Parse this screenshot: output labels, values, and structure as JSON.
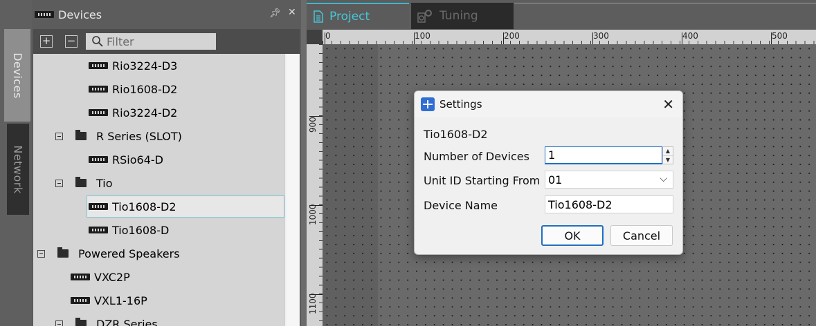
{
  "side_tabs": {
    "devices": "Devices",
    "network": "Network"
  },
  "devices_panel": {
    "title": "Devices",
    "filter_placeholder": "Filter",
    "expand_all": "+",
    "collapse_all": "−"
  },
  "tree": [
    {
      "label": "Rio3224-D3",
      "kind": "device",
      "indent": 80
    },
    {
      "label": "Rio1608-D2",
      "kind": "device",
      "indent": 80
    },
    {
      "label": "Rio3224-D2",
      "kind": "device",
      "indent": 80
    },
    {
      "label": "R Series (SLOT)",
      "kind": "folder",
      "indent": 32
    },
    {
      "label": "RSio64-D",
      "kind": "device",
      "indent": 80
    },
    {
      "label": "Tio",
      "kind": "folder",
      "indent": 32
    },
    {
      "label": "Tio1608-D2",
      "kind": "device",
      "indent": 80,
      "selected": true
    },
    {
      "label": "Tio1608-D",
      "kind": "device",
      "indent": 80
    },
    {
      "label": "Powered Speakers",
      "kind": "folder",
      "indent": 6
    },
    {
      "label": "VXC2P",
      "kind": "device",
      "indent": 54
    },
    {
      "label": "VXL1-16P",
      "kind": "device",
      "indent": 54
    },
    {
      "label": "DZR Series",
      "kind": "folder",
      "indent": 32
    }
  ],
  "doc_tabs": {
    "project": "Project",
    "tuning": "Tuning"
  },
  "ruler": {
    "h_labels": [
      "0",
      "100",
      "200",
      "300",
      "400",
      "500"
    ],
    "v_labels": [
      "900",
      "1000",
      "1100"
    ]
  },
  "dialog": {
    "title": "Settings",
    "device_model": "Tio1608-D2",
    "number_of_devices_label": "Number of Devices",
    "number_of_devices_value": "1",
    "unit_id_label": "Unit ID Starting From",
    "unit_id_value": "01",
    "device_name_label": "Device Name",
    "device_name_value": "Tio1608-D2",
    "ok": "OK",
    "cancel": "Cancel"
  },
  "colors": {
    "accent": "#3bb9cf",
    "focus": "#1f6fc1"
  },
  "icons": [
    "device-icon",
    "folder-icon",
    "pin-icon",
    "close-icon",
    "search-icon",
    "project-icon",
    "tuning-icon",
    "settings-app-icon",
    "chevron-down-icon"
  ]
}
